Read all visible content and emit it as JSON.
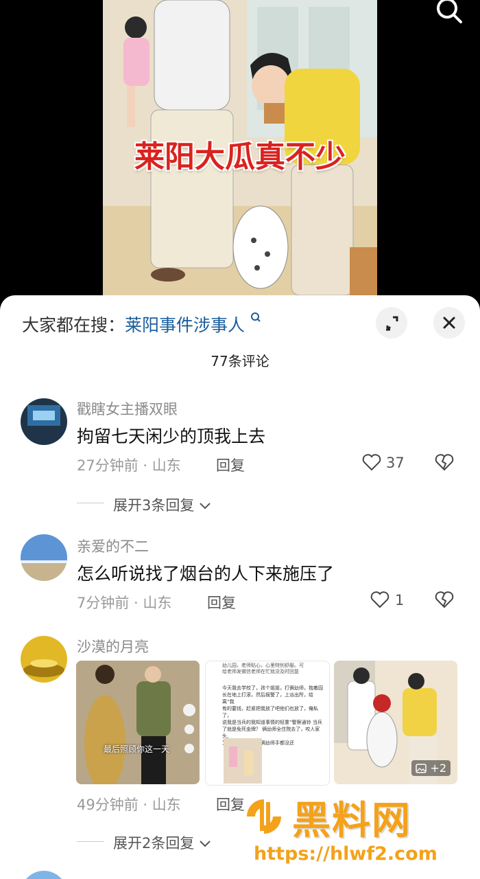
{
  "video": {
    "overlay_text": "莱阳大瓜真不少",
    "search_icon": "search-icon"
  },
  "sheet": {
    "trending_label": "大家都在搜：",
    "trending_query": "莱阳事件涉事人",
    "comment_count": "77条评论",
    "expand_icon": "expand-icon",
    "close_icon": "close-icon"
  },
  "comments": [
    {
      "username": "戳瞎女主播双眼",
      "text": "拘留七天闲少的顶我上去",
      "time": "27分钟前",
      "location": "山东",
      "reply": "回复",
      "likes": "37",
      "expand": "展开3条回复"
    },
    {
      "username": "亲爱的不二",
      "text": "怎么听说找了烟台的人下来施压了",
      "time": "7分钟前",
      "location": "山东",
      "reply": "回复",
      "likes": "1"
    },
    {
      "username": "沙漠的月亮",
      "time": "49分钟前",
      "location": "山东",
      "reply": "回复",
      "expand": "展开2条回复",
      "images": [
        {
          "caption": "最后照顾你这一天"
        },
        {
          "lines": [
            "幼儿园，老师贴心，心里特别舒服。可",
            "给老师发微信老师在忙就没及时回复"
          ],
          "para": [
            "今天我去学校了，孩个姐姐，打俩幼师，抱着园",
            "长在地上打滚，然后报警了，上派出所，给离“我",
            "有的要钱，赶紧把我放了吧他们也放了，俺私了，",
            "说我是当兵的我知道事情的轻重”警察通铃 当兵",
            "了就是免死金牌？ 俩幼师全住院去了，咬人家头,",
            "又打又挂又咬，人俩幼师手都没还"
          ]
        },
        {
          "badge": "+2"
        }
      ]
    }
  ],
  "watermark": {
    "brand": "黑料网",
    "url": "https://hlwf2.com"
  }
}
